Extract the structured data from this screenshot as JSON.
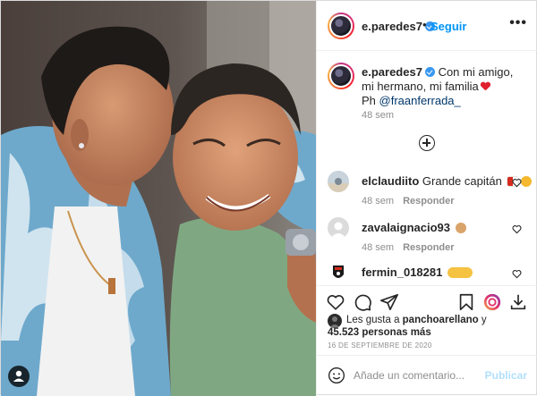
{
  "post": {
    "author": "e.paredes7",
    "follow_label": "Seguir",
    "separator": "•",
    "more_label": "•••",
    "caption": {
      "username": "e.paredes7",
      "text": "Con mi amigo, mi hermano, mi familia",
      "credit_prefix": "Ph ",
      "mention": "@fraanferrada_",
      "time": "48 sem"
    },
    "comments": [
      {
        "username": "elclaudiito",
        "text": "Grande capitán",
        "time": "48 sem",
        "reply_label": "Responder"
      },
      {
        "username": "zavalaignacio93",
        "text": "",
        "time": "48 sem",
        "reply_label": "Responder"
      },
      {
        "username": "fermin_018281",
        "text": "",
        "time": "",
        "reply_label": ""
      }
    ],
    "likes": {
      "prefix": "Les gusta a ",
      "user": "panchoarellano",
      "suffix": " y",
      "others": "45.523 personas más"
    },
    "date": "16 DE SEPTIEMBRE DE 2020",
    "comment_input": {
      "placeholder": "Añade un comentario...",
      "value": ""
    },
    "publish_label": "Publicar"
  },
  "icons": {
    "verified": "verified-badge-icon",
    "more": "more-options-icon",
    "load_more": "plus-circle-icon",
    "like": "heart-outline-icon",
    "comment": "comment-bubble-icon",
    "share": "paper-plane-icon",
    "save": "bookmark-icon",
    "story_ring": "instagram-ring-icon",
    "download": "download-icon",
    "emoji": "smiley-icon",
    "user_tag": "user-tag-icon"
  },
  "colors": {
    "accent": "#0095f6",
    "mention": "#00376b",
    "muted": "#8e8e8e",
    "publish_disabled": "#b2dffc",
    "heart_red": "#e0202e"
  }
}
